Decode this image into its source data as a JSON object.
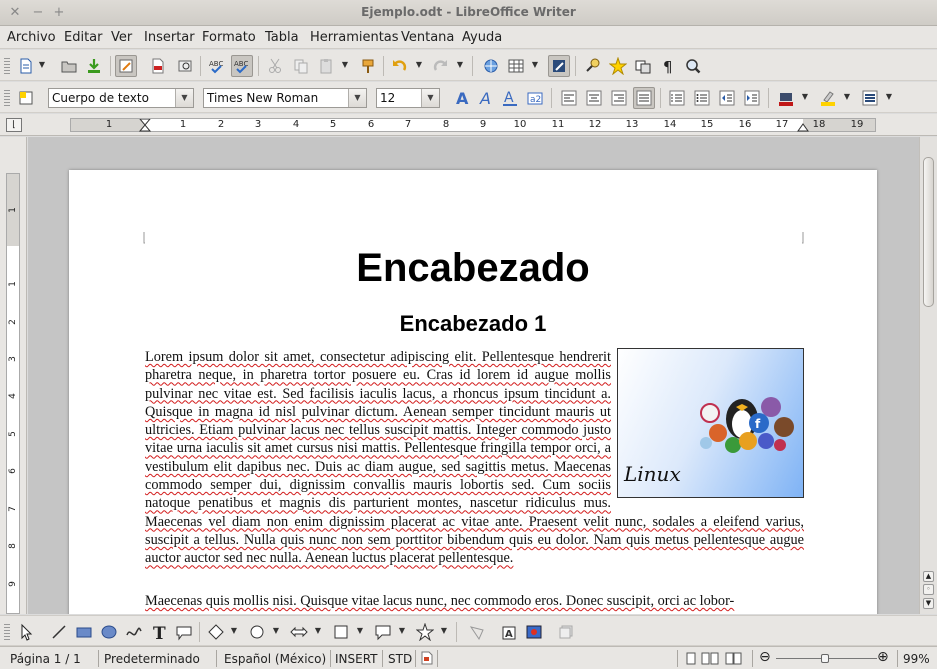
{
  "window": {
    "title": "Ejemplo.odt - LibreOffice Writer",
    "close": "✕",
    "minimize": "−",
    "maximize": "+"
  },
  "menu": [
    "Archivo",
    "Editar",
    "Ver",
    "Insertar",
    "Formato",
    "Tabla",
    "Herramientas",
    "Ventana",
    "Ayuda"
  ],
  "formatting": {
    "paragraph_style": "Cuerpo de texto",
    "font_name": "Times New Roman",
    "font_size": "12"
  },
  "ruler": {
    "h_labels": [
      "1",
      "1",
      "2",
      "3",
      "4",
      "5",
      "6",
      "7",
      "8",
      "9",
      "10",
      "11",
      "12",
      "13",
      "14",
      "15",
      "16",
      "17",
      "18",
      "19"
    ],
    "v_labels": [
      "1",
      "1",
      "2",
      "3",
      "4",
      "5",
      "6",
      "7",
      "8",
      "9"
    ]
  },
  "document": {
    "heading_main": "Encabezado",
    "heading_1": "Encabezado 1",
    "para1": "Lorem ipsum dolor sit amet, consectetur adipiscing elit. Pellentesque hendrerit pharetra neque, in pharetra tortor posuere eu. Cras id lorem id augue mollis pulvinar nec vitae est. Sed facilisis iaculis lacus, a rhoncus ipsum tincidunt a. Quisque in magna id nisl pulvinar dictum. Aenean semper tincidunt mauris ut ultricies. Etiam pulvinar lacus nec tellus suscipit mattis. Integer commodo justo vitae urna iaculis sit amet cursus nisi mattis. Pellentesque fringilla tempor orci, a vestibulum elit dapibus nec. Duis ac diam augue, sed sagittis metus. Maecenas commodo semper dui, dignissim convallis mauris lobortis sed. Cum sociis natoque penatibus et magnis dis parturient montes, nascetur ridiculus mus. Maecenas vel diam non enim dignissim placerat ac vitae ante. Praesent velit nunc, sodales a eleifend varius, suscipit a tellus. Nulla quis nunc non sem porttitor bibendum quis eu dolor. Nam quis metus pellentesque augue auctor auctor sed nec nulla. Aenean luctus placerat pellentesque.",
    "para2": "Maecenas quis mollis nisi. Quisque vitae lacus nunc, nec commodo eros. Donec suscipit, orci ac lobor-",
    "image_text": "Linux"
  },
  "status": {
    "page": "Página  1 / 1",
    "style": "Predeterminado",
    "language": "Español (México)",
    "insert": "INSERT",
    "selection": "STD",
    "zoom_percent": 99,
    "zoom": "99%"
  },
  "colors": {
    "accent_highlight": "#ffd200",
    "font_color": "#c01818",
    "spell_underline": "#d21b1b"
  }
}
